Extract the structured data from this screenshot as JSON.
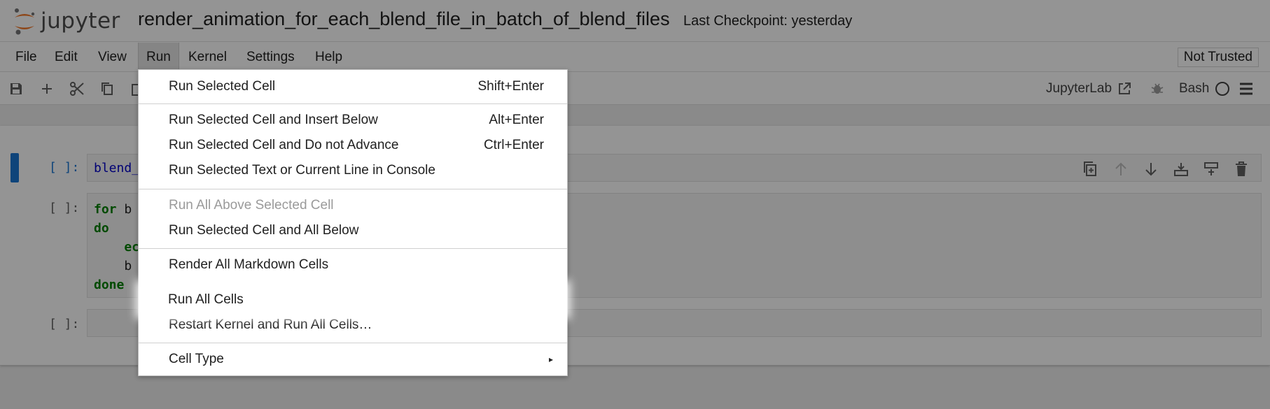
{
  "header": {
    "logo_text": "jupyter",
    "notebook_title": "render_animation_for_each_blend_file_in_batch_of_blend_files",
    "checkpoint": "Last Checkpoint: yesterday"
  },
  "menubar": {
    "items": [
      "File",
      "Edit",
      "View",
      "Run",
      "Kernel",
      "Settings",
      "Help"
    ],
    "active": "Run",
    "trust_status": "Not Trusted"
  },
  "toolbar": {
    "icons": [
      "save-icon",
      "add-icon",
      "cut-icon",
      "copy-icon",
      "paste-icon"
    ],
    "open_in_label": "JupyterLab",
    "kernel_name": "Bash",
    "right_icons": [
      "external-link-icon",
      "bug-icon",
      "kernel-status-circle-icon",
      "menu-icon"
    ]
  },
  "cells": [
    {
      "prompt": "[ ]:",
      "lines": [
        [
          {
            "t": "blend_",
            "c": "var"
          }
        ]
      ]
    },
    {
      "prompt": "[ ]:",
      "lines": [
        [
          {
            "t": "for",
            "c": "kw"
          },
          {
            "t": " b",
            "c": "txt"
          }
        ],
        [
          {
            "t": "do",
            "c": "kw"
          }
        ],
        [
          {
            "t": "    ec",
            "c": "kw"
          }
        ],
        [
          {
            "t": "    b",
            "c": "txt"
          }
        ],
        [
          {
            "t": "done",
            "c": "kw"
          }
        ]
      ]
    },
    {
      "prompt": "[ ]:",
      "lines": []
    }
  ],
  "cell_toolbar_icons": [
    "duplicate-cell-icon",
    "move-up-icon",
    "move-down-icon",
    "insert-above-icon",
    "insert-below-icon",
    "delete-cell-icon"
  ],
  "run_menu": {
    "items": [
      {
        "label": "Run Selected Cell",
        "shortcut": "Shift+Enter"
      },
      {
        "label": "Run Selected Cell and Insert Below",
        "shortcut": "Alt+Enter"
      },
      {
        "label": "Run Selected Cell and Do not Advance",
        "shortcut": "Ctrl+Enter"
      },
      {
        "label": "Run Selected Text or Current Line in Console",
        "shortcut": ""
      },
      {
        "label": "Run All Above Selected Cell",
        "shortcut": "",
        "disabled": true
      },
      {
        "label": "Run Selected Cell and All Below",
        "shortcut": ""
      },
      {
        "label": "Render All Markdown Cells",
        "shortcut": ""
      },
      {
        "label": "Run All Cells",
        "shortcut": "",
        "highlighted": true
      },
      {
        "label": "Restart Kernel and Run All Cells…",
        "shortcut": ""
      },
      {
        "label": "Cell Type",
        "shortcut": "",
        "submenu": true
      }
    ]
  },
  "colors": {
    "accent": "#1976d2",
    "logo_orange": "#f37726",
    "keyword": "#008000",
    "variable": "#0000c8"
  }
}
